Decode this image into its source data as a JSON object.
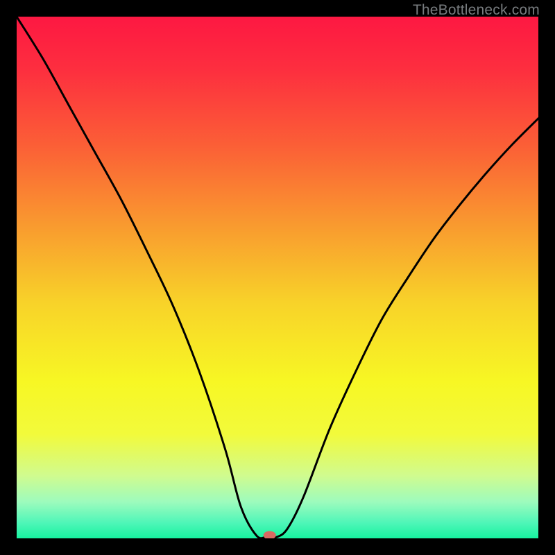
{
  "attribution": "TheBottleneck.com",
  "chart_data": {
    "type": "line",
    "title": "",
    "xlabel": "",
    "ylabel": "",
    "xlim": [
      0,
      100
    ],
    "ylim": [
      0,
      100
    ],
    "grid": false,
    "series": [
      {
        "name": "bottleneck-curve",
        "x": [
          0,
          5,
          10,
          15,
          20,
          25,
          30,
          35,
          40,
          43,
          46,
          48,
          50,
          52,
          55,
          60,
          65,
          70,
          75,
          80,
          85,
          90,
          95,
          100
        ],
        "y": [
          100,
          92,
          83,
          74,
          65,
          55,
          44.5,
          32,
          17,
          6,
          0.5,
          0.3,
          0.3,
          2,
          8,
          21,
          32,
          42,
          50,
          57.5,
          64,
          70,
          75.5,
          80.5
        ]
      }
    ],
    "marker": {
      "x": 48.5,
      "y": 0.6,
      "color": "#d86a63"
    },
    "background_gradient": {
      "stops": [
        {
          "offset": 0.0,
          "color": "#fd1842"
        },
        {
          "offset": 0.1,
          "color": "#fd2e3f"
        },
        {
          "offset": 0.25,
          "color": "#fb6036"
        },
        {
          "offset": 0.4,
          "color": "#f99a2f"
        },
        {
          "offset": 0.55,
          "color": "#f8d329"
        },
        {
          "offset": 0.7,
          "color": "#f7f724"
        },
        {
          "offset": 0.8,
          "color": "#f2fa3b"
        },
        {
          "offset": 0.88,
          "color": "#d0fb8f"
        },
        {
          "offset": 0.93,
          "color": "#9dfbbd"
        },
        {
          "offset": 0.97,
          "color": "#4ff6b8"
        },
        {
          "offset": 1.0,
          "color": "#17f3a0"
        }
      ]
    }
  }
}
